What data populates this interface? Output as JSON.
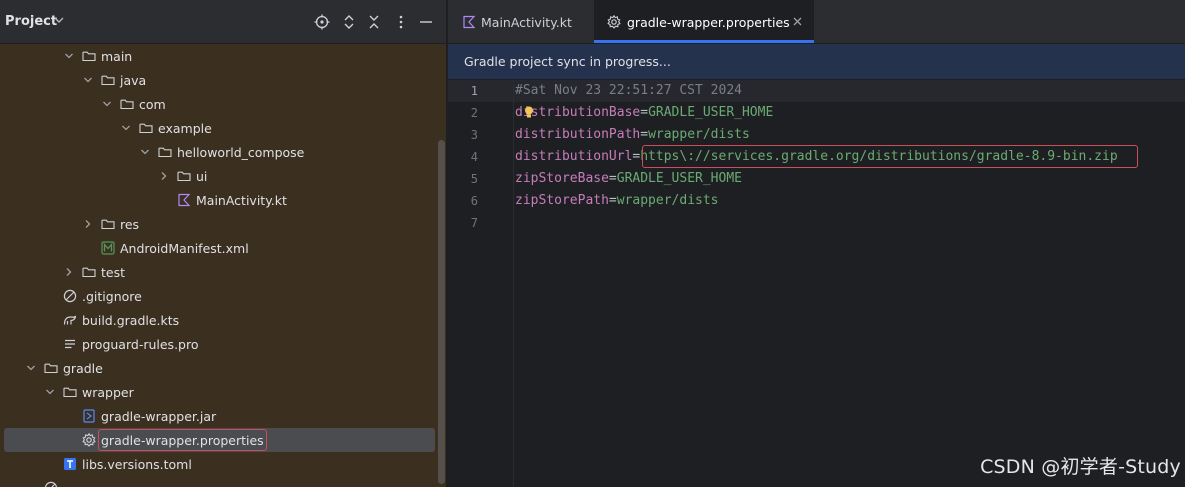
{
  "project_panel": {
    "title": "Project",
    "tree": [
      {
        "label": "main",
        "type": "folder",
        "expanded": true
      },
      {
        "label": "java",
        "type": "folder",
        "expanded": true
      },
      {
        "label": "com",
        "type": "folder",
        "expanded": true
      },
      {
        "label": "example",
        "type": "folder",
        "expanded": true
      },
      {
        "label": "helloworld_compose",
        "type": "folder",
        "expanded": true
      },
      {
        "label": "ui",
        "type": "folder",
        "expanded": false
      },
      {
        "label": "MainActivity.kt",
        "type": "kotlin-file"
      },
      {
        "label": "res",
        "type": "folder",
        "expanded": false
      },
      {
        "label": "AndroidManifest.xml",
        "type": "manifest-file"
      },
      {
        "label": "test",
        "type": "folder",
        "expanded": false
      },
      {
        "label": ".gitignore",
        "type": "ignore-file"
      },
      {
        "label": "build.gradle.kts",
        "type": "gradle-file"
      },
      {
        "label": "proguard-rules.pro",
        "type": "text-file"
      },
      {
        "label": "gradle",
        "type": "folder",
        "expanded": true
      },
      {
        "label": "wrapper",
        "type": "folder",
        "expanded": true
      },
      {
        "label": "gradle-wrapper.jar",
        "type": "jar-file"
      },
      {
        "label": "gradle-wrapper.properties",
        "type": "properties-file",
        "selected": true
      },
      {
        "label": "libs.versions.toml",
        "type": "toml-file"
      }
    ]
  },
  "editor": {
    "tabs": [
      {
        "label": "MainActivity.kt",
        "icon": "kotlin-icon",
        "active": false
      },
      {
        "label": "gradle-wrapper.properties",
        "icon": "gear-icon",
        "active": true
      }
    ],
    "banner": "Gradle project sync in progress...",
    "line_numbers": [
      "1",
      "2",
      "3",
      "4",
      "5",
      "6",
      "7"
    ],
    "lines": [
      {
        "comment": "#Sat Nov 23 22:51:27 CST 2024"
      },
      {
        "key": "distributionBase",
        "eq": "=",
        "value": "GRADLE_USER_HOME"
      },
      {
        "key": "distributionPath",
        "eq": "=",
        "value": "wrapper/dists"
      },
      {
        "key": "distributionUrl",
        "eq": "=",
        "value": "https\\://services.gradle.org/distributions/gradle-8.9-bin.zip"
      },
      {
        "key": "zipStoreBase",
        "eq": "=",
        "value": "GRADLE_USER_HOME"
      },
      {
        "key": "zipStorePath",
        "eq": "=",
        "value": "wrapper/dists"
      },
      {
        "comment": ""
      }
    ]
  },
  "watermark": "CSDN @初学者-Study",
  "colors": {
    "panel_bg": "#3b2f20",
    "editor_bg": "#1e1f22",
    "accent": "#3574f0",
    "highlight_border": "#c94f5a",
    "key": "#c77dbb",
    "value": "#6aab73"
  }
}
